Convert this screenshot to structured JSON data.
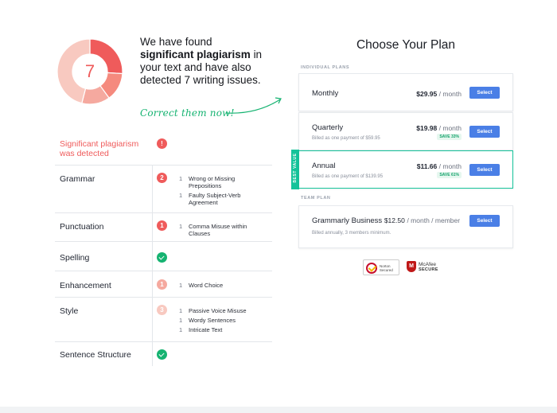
{
  "summary": {
    "score": "7",
    "headline_part1": "We have found",
    "headline_bold": "significant plagiarism",
    "headline_part2": "in your text and have also detected 7 writing issues.",
    "cta": "Correct them now!"
  },
  "donut_segments": [
    {
      "fraction": 0.26,
      "color": "#ef5b5b"
    },
    {
      "fraction": 0.14,
      "color": "#f58a7e"
    },
    {
      "fraction": 0.14,
      "color": "#f5a99f"
    },
    {
      "fraction": 0.46,
      "color": "#f8c9c0"
    }
  ],
  "issues": {
    "alert_label_line1": "Significant plagiarism",
    "alert_label_line2": "was detected",
    "alert_badge": "!",
    "grammar": {
      "label": "Grammar",
      "count": "2",
      "items": [
        {
          "count": "1",
          "text": "Wrong or Missing Prepositions"
        },
        {
          "count": "1",
          "text": "Faulty Subject-Verb Agreement"
        }
      ]
    },
    "punctuation": {
      "label": "Punctuation",
      "count": "1",
      "items": [
        {
          "count": "1",
          "text": "Comma Misuse within Clauses"
        }
      ]
    },
    "spelling": {
      "label": "Spelling"
    },
    "enhancement": {
      "label": "Enhancement",
      "count": "1",
      "items": [
        {
          "count": "1",
          "text": "Word Choice"
        }
      ]
    },
    "style": {
      "label": "Style",
      "count": "3",
      "items": [
        {
          "count": "1",
          "text": "Passive Voice Misuse"
        },
        {
          "count": "1",
          "text": "Wordy Sentences"
        },
        {
          "count": "1",
          "text": "Intricate Text"
        }
      ]
    },
    "sentence_structure": {
      "label": "Sentence Structure"
    }
  },
  "plans": {
    "title": "Choose Your Plan",
    "individual_label": "INDIVIDUAL PLANS",
    "team_label": "TEAM PLAN",
    "best_value": "BEST VALUE",
    "select_label": "Select",
    "per_month": "/ month",
    "monthly": {
      "name": "Monthly",
      "price": "$29.95"
    },
    "quarterly": {
      "name": "Quarterly",
      "price": "$19.98",
      "billed": "Billed as one payment of $59.95",
      "save": "SAVE 33%"
    },
    "annual": {
      "name": "Annual",
      "price": "$11.66",
      "billed": "Billed as one payment of $139.95",
      "save": "SAVE 61%"
    },
    "business": {
      "name": "Grammarly Business",
      "price": "$12.50",
      "per": "/ month / member",
      "billed": "Billed annually, 3 members minimum."
    }
  },
  "trust": {
    "norton_line1": "Norton",
    "norton_line2": "Secured",
    "mcafee_name": "McAfee",
    "mcafee_secure": "SECURE",
    "mcafee_mark": "M"
  }
}
